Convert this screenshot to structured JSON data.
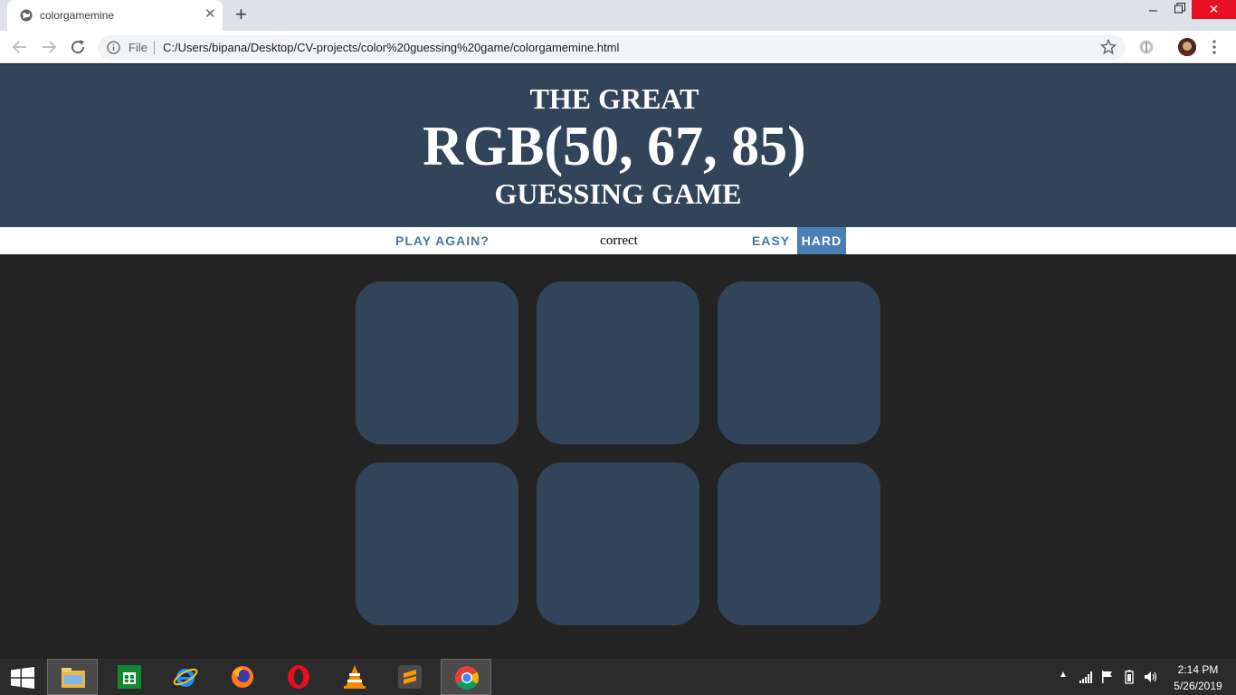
{
  "browser": {
    "tab_title": "colorgamemine",
    "file_label": "File",
    "url": "C:/Users/bipana/Desktop/CV-projects/color%20guessing%20game/colorgamemine.html",
    "new_tab_symbol": "+",
    "tab_close_symbol": "✕",
    "window_close_symbol": "✕",
    "window_min_symbol": "–"
  },
  "game": {
    "header_line1": "THE GREAT",
    "target_color": "RGB(50, 67, 85)",
    "header_line3": "GUESSING GAME",
    "reset_label": "PLAY AGAIN?",
    "message": "correct",
    "easy_label": "EASY",
    "hard_label": "HARD",
    "selected_mode": "HARD",
    "squares": [
      {
        "color": "#32445a"
      },
      {
        "color": "#32445a"
      },
      {
        "color": "#32445a"
      },
      {
        "color": "#32445a"
      },
      {
        "color": "#32445a"
      },
      {
        "color": "#32445a"
      }
    ]
  },
  "colors": {
    "header_bg": "#32445a",
    "page_bg": "#232323",
    "accent": "#4a76a8",
    "selected_bg": "#4a7fb5"
  },
  "taskbar": {
    "apps": [
      "start-menu-icon",
      "file-explorer-icon",
      "store-icon",
      "internet-explorer-icon",
      "firefox-icon",
      "opera-icon",
      "vlc-icon",
      "sublime-text-icon",
      "chrome-icon"
    ],
    "time": "2:14 PM",
    "date": "5/26/2019"
  }
}
